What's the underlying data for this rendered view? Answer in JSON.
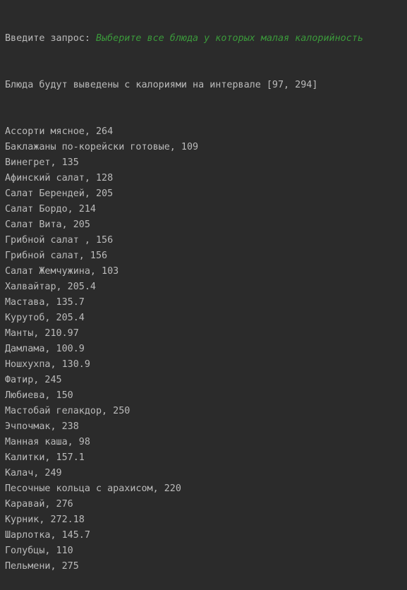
{
  "console": {
    "prompt_label": "Введите запрос: ",
    "user_input": "Выберите все блюда у которых малая калорийность",
    "summary_line": "Блюда будут выведены с калориями на интервале [97, 294]",
    "results": [
      "Ассорти мясное, 264",
      "Баклажаны по-корейски готовые, 109",
      "Винегрет, 135",
      "Афинский салат, 128",
      "Салат Берендей, 205",
      "Салат Бордо, 214",
      "Салат Вита, 205",
      "Грибной салат , 156",
      "Грибной салат, 156",
      "Салат Жемчужина, 103",
      "Халвайтар, 205.4",
      "Мастава, 135.7",
      "Курутоб, 205.4",
      "Манты, 210.97",
      "Дамлама, 100.9",
      "Ношхухпа, 130.9",
      "Фатир, 245",
      "Любиева, 150",
      "Мастобай гелакдор, 250",
      "Эчпочмак, 238",
      "Манная каша, 98",
      "Калитки, 157.1",
      "Калач, 249",
      "Песочные кольца с арахисом, 220",
      "Каравай, 276",
      "Курник, 272.18",
      "Шарлотка, 145.7",
      "Голубцы, 110",
      "Пельмени, 275"
    ]
  },
  "colors": {
    "background": "#2b2b2b",
    "text": "#bbbbbb",
    "user_input": "#3b9a3b"
  }
}
